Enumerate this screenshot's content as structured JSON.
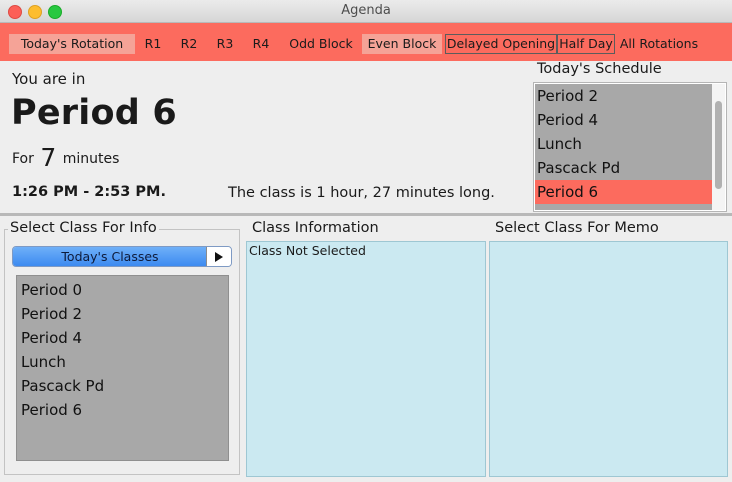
{
  "window": {
    "title": "Agenda"
  },
  "rotation_bar": {
    "buttons": [
      {
        "label": "Today's Rotation"
      },
      {
        "label": "R1"
      },
      {
        "label": "R2"
      },
      {
        "label": "R3"
      },
      {
        "label": "R4"
      },
      {
        "label": "Odd Block"
      },
      {
        "label": "Even Block"
      },
      {
        "label": "Delayed Opening"
      },
      {
        "label": "Half Day"
      },
      {
        "label": "All Rotations"
      }
    ],
    "color": "#fc6b5e"
  },
  "current": {
    "you_are_in": "You are in",
    "period": "Period 6",
    "for_prefix": "For",
    "minutes_value": "7",
    "minutes_suffix": "minutes",
    "time_range": "1:26 PM - 2:53 PM.",
    "length_text": "The class is 1 hour, 27 minutes long."
  },
  "schedule": {
    "title": "Today's Schedule",
    "items": [
      "Period 2",
      "Period 4",
      "Lunch",
      "Pascack Pd",
      "Period 6"
    ],
    "selected": "Period 6"
  },
  "class_info_select": {
    "title": "Select Class For Info",
    "dropdown_value": "Today's Classes",
    "items": [
      "Period 0",
      "Period 2",
      "Period 4",
      "Lunch",
      "Pascack Pd",
      "Period 6"
    ]
  },
  "class_information": {
    "title": "Class Information",
    "text": "Class Not Selected"
  },
  "memo": {
    "title": "Select Class For Memo"
  }
}
